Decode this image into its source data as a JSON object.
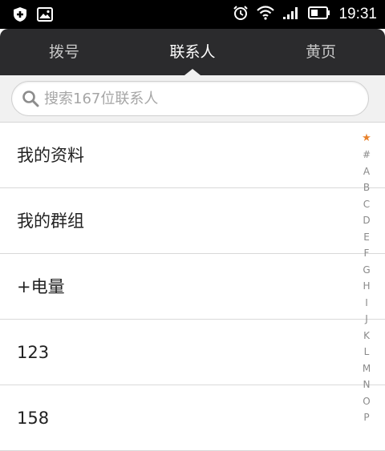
{
  "status_bar": {
    "time": "19:31",
    "left_icons": [
      "shield-icon",
      "image-icon"
    ],
    "right_icons": [
      "alarm-icon",
      "wifi-icon",
      "signal-icon",
      "battery-icon"
    ]
  },
  "tabs": [
    {
      "label": "拨号",
      "active": false
    },
    {
      "label": "联系人",
      "active": true
    },
    {
      "label": "黄页",
      "active": false
    }
  ],
  "search": {
    "placeholder": "搜索167位联系人"
  },
  "contacts": [
    {
      "label": "我的资料"
    },
    {
      "label": "我的群组"
    },
    {
      "label": "+电量"
    },
    {
      "label": "123"
    },
    {
      "label": "158"
    }
  ],
  "index_letters": [
    "★",
    "#",
    "A",
    "B",
    "C",
    "D",
    "E",
    "F",
    "G",
    "H",
    "I",
    "J",
    "K",
    "L",
    "M",
    "N",
    "O",
    "P"
  ],
  "colors": {
    "status_bar_bg": "#000000",
    "tab_bar_bg": "#2b2b2d",
    "search_area_bg": "#f1f1f1",
    "star_accent": "#e8822c"
  }
}
